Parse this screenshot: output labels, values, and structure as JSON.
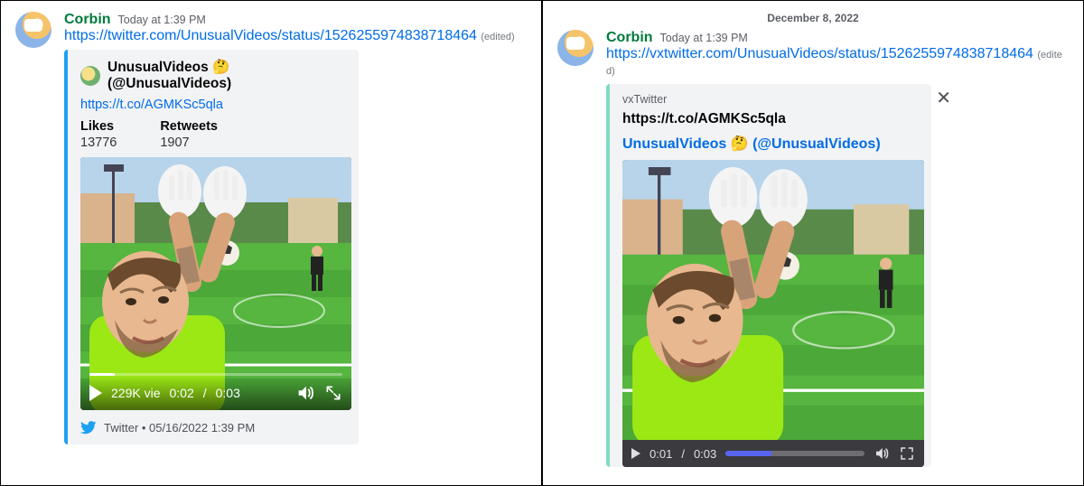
{
  "left": {
    "author": "Corbin",
    "timestamp": "Today at 1:39 PM",
    "link": "https://twitter.com/UnusualVideos/status/1526255974838718464",
    "edited": "(edited)",
    "embed": {
      "author_name": "UnusualVideos 🤔 (@UnusualVideos)",
      "short_link": "https://t.co/AGMKSc5qla",
      "likes_label": "Likes",
      "likes_value": "13776",
      "retweets_label": "Retweets",
      "retweets_value": "1907",
      "views": "229K vie",
      "time_current": "0:02",
      "time_total": "0:03",
      "footer": "Twitter • 05/16/2022 1:39 PM"
    }
  },
  "right": {
    "date_divider": "December 8, 2022",
    "author": "Corbin",
    "timestamp": "Today at 1:39 PM",
    "link": "https://vxtwitter.com/UnusualVideos/status/1526255974838718464",
    "edited": "(edited)",
    "embed": {
      "provider": "vxTwitter",
      "title": "https://t.co/AGMKSc5qla",
      "author_link": "UnusualVideos 🤔 (@UnusualVideos)",
      "time_current": "0:01",
      "time_total": "0:03"
    }
  }
}
